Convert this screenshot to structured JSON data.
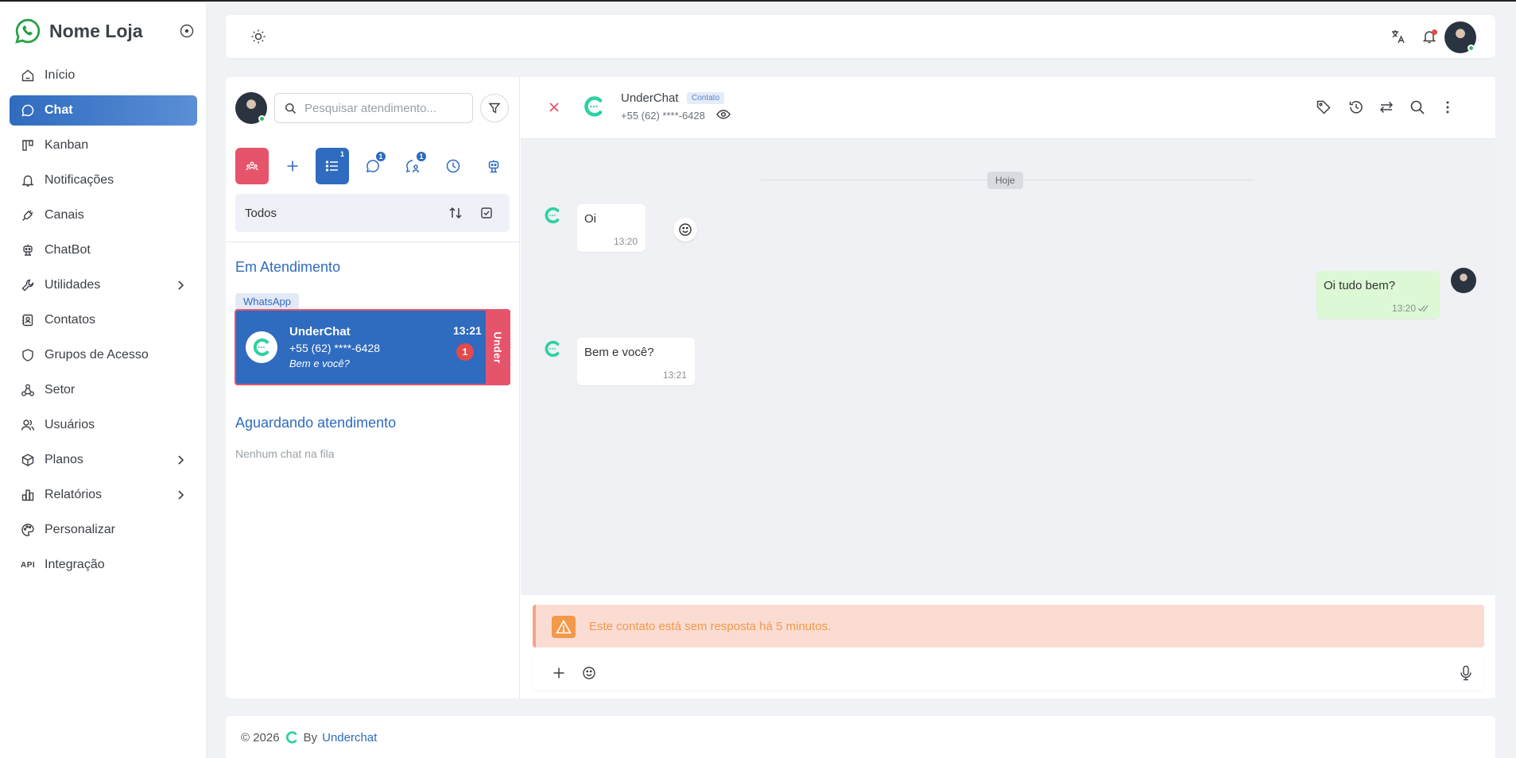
{
  "brand": {
    "name": "Nome Loja"
  },
  "nav": [
    {
      "label": "Início",
      "icon": "home-icon"
    },
    {
      "label": "Chat",
      "icon": "chat-bubble-icon",
      "active": true
    },
    {
      "label": "Kanban",
      "icon": "kanban-icon"
    },
    {
      "label": "Notificações",
      "icon": "bell-icon"
    },
    {
      "label": "Canais",
      "icon": "plug-icon"
    },
    {
      "label": "ChatBot",
      "icon": "robot-icon"
    },
    {
      "label": "Utilidades",
      "icon": "wrench-icon",
      "chevron": true
    },
    {
      "label": "Contatos",
      "icon": "contacts-icon"
    },
    {
      "label": "Grupos de Acesso",
      "icon": "shield-icon"
    },
    {
      "label": "Setor",
      "icon": "sector-icon"
    },
    {
      "label": "Usuários",
      "icon": "users-icon"
    },
    {
      "label": "Planos",
      "icon": "box-icon",
      "chevron": true
    },
    {
      "label": "Relatórios",
      "icon": "chart-icon",
      "chevron": true
    },
    {
      "label": "Personalizar",
      "icon": "palette-icon"
    },
    {
      "label": "Integração",
      "icon": "api-icon",
      "icon_text": "API"
    }
  ],
  "search": {
    "placeholder": "Pesquisar atendimento..."
  },
  "tabs": {
    "badge_list": "1",
    "badge_chat": "1",
    "badge_user": "1"
  },
  "filter": {
    "label": "Todos"
  },
  "sections": {
    "in_service": "Em Atendimento",
    "waiting": "Aguardando atendimento",
    "empty_queue": "Nenhum chat na fila"
  },
  "ticket": {
    "channel": "WhatsApp",
    "name": "UnderChat",
    "phone": "+55 (62) ****-6428",
    "last_message": "Bem e você?",
    "time": "13:21",
    "unread": "1",
    "queue": "Under"
  },
  "chat_header": {
    "name": "UnderChat",
    "tag": "Contato",
    "phone": "+55 (62) ****-6428"
  },
  "day_separator": "Hoje",
  "messages": [
    {
      "text": "Oi",
      "time": "13:20",
      "direction": "in"
    },
    {
      "text": "Oi tudo bem?",
      "time": "13:20",
      "direction": "out"
    },
    {
      "text": "Bem e você?",
      "time": "13:21",
      "direction": "in"
    }
  ],
  "warning": {
    "text": "Este contato está sem resposta há 5 minutos."
  },
  "footer": {
    "year": "© 2026",
    "by": "By",
    "link": "Underchat"
  },
  "colors": {
    "primary": "#2f6bbf",
    "danger": "#e5546b",
    "warning": "#f2994a",
    "whatsapp": "#25d366",
    "underchat_logo": "#2ed1a2"
  }
}
